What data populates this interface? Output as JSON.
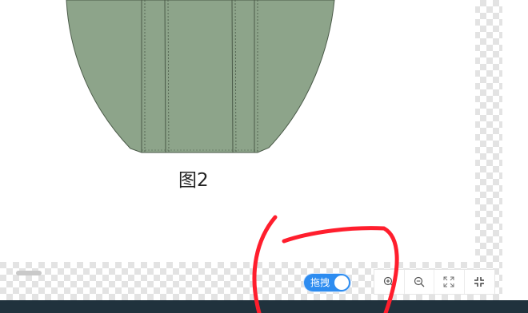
{
  "figure": {
    "caption": "图2"
  },
  "toolbar": {
    "drag_toggle": {
      "label": "拖拽",
      "enabled": true
    },
    "buttons": [
      {
        "name": "zoom-in",
        "icon": "zoom-in-icon"
      },
      {
        "name": "zoom-out",
        "icon": "zoom-out-icon"
      },
      {
        "name": "fit-to-screen",
        "icon": "expand-icon"
      },
      {
        "name": "actual-size",
        "icon": "collapse-icon"
      }
    ]
  },
  "colors": {
    "garment_fill": "#8da48a",
    "garment_stroke": "#4a5a48",
    "toggle_on": "#2d8cf0",
    "annotation_stroke": "#ff1e2d",
    "bottom_bar": "#20323d"
  }
}
